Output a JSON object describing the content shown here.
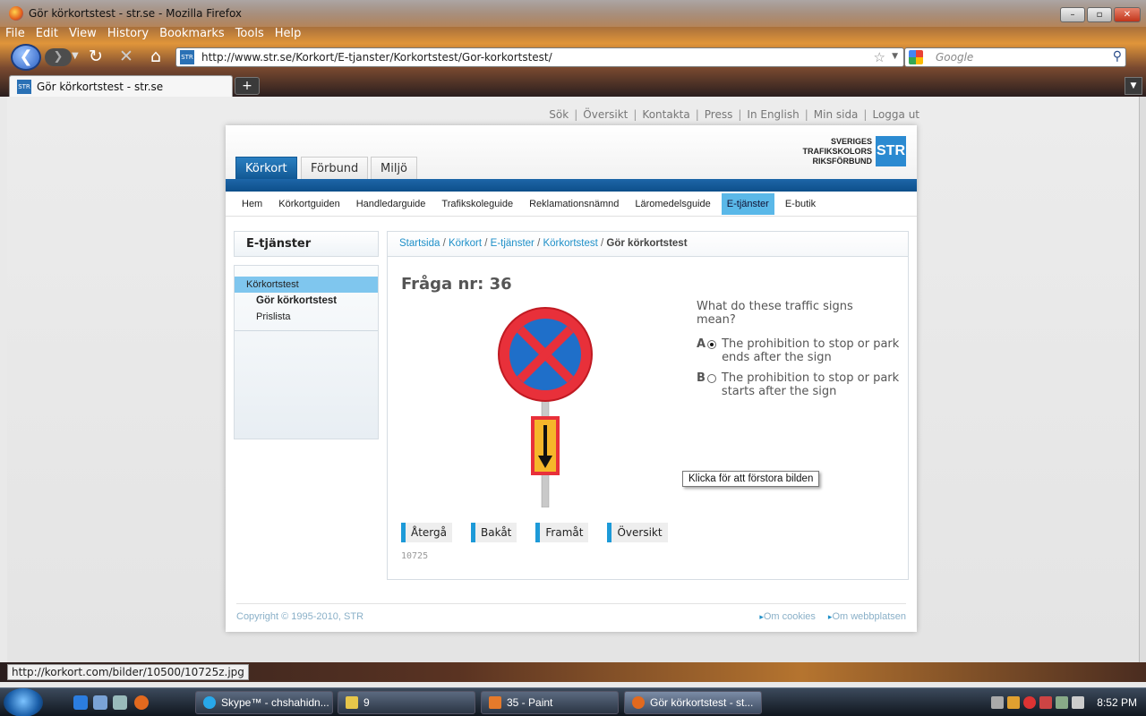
{
  "window": {
    "title": "Gör körkortstest - str.se - Mozilla Firefox"
  },
  "menu": [
    "File",
    "Edit",
    "View",
    "History",
    "Bookmarks",
    "Tools",
    "Help"
  ],
  "address": {
    "url": "http://www.str.se/Korkort/E-tjanster/Korkortstest/Gor-korkortstest/",
    "search_placeholder": "Google"
  },
  "tab": {
    "title": "Gör körkortstest - str.se",
    "new_tab": "+"
  },
  "site": {
    "toplinks": [
      "Sök",
      "Översikt",
      "Kontakta",
      "Press",
      "In English",
      "Min sida",
      "Logga ut"
    ],
    "maintabs": [
      "Körkort",
      "Förbund",
      "Miljö"
    ],
    "logo": {
      "line1": "SVERIGES",
      "line2": "TRAFIKSKOLORS",
      "line3": "RIKSFÖRBUND",
      "mark": "STR",
      "color": "#2b8ad1"
    },
    "subnav": [
      "Hem",
      "Körkortguiden",
      "Handledarguide",
      "Trafikskoleguide",
      "Reklamationsnämnd",
      "Läromedelsguide",
      "E-tjänster",
      "E-butik"
    ],
    "left": {
      "heading": "E-tjänster",
      "items": [
        "Körkortstest",
        "Gör körkortstest",
        "Prislista"
      ]
    },
    "breadcrumb": [
      "Startsida",
      "Körkort",
      "E-tjänster",
      "Körkortstest",
      "Gör körkortstest"
    ],
    "question": {
      "title": "Fråga nr: 36",
      "text": "What do these traffic signs mean?",
      "options": [
        {
          "letter": "A",
          "text": "The prohibition to stop or park ends after the sign",
          "selected": true
        },
        {
          "letter": "B",
          "text": "The prohibition to stop or park starts after the sign",
          "selected": false
        }
      ],
      "tooltip": "Klicka för att förstora bilden",
      "buttons": [
        "Återgå",
        "Bakåt",
        "Framåt",
        "Översikt"
      ],
      "id": "10725"
    },
    "footer": {
      "copyright": "Copyright © 1995-2010, STR",
      "links": [
        "Om cookies",
        "Om webbplatsen"
      ]
    }
  },
  "status": {
    "text": "http://korkort.com/bilder/10500/10725z.jpg"
  },
  "taskbar": {
    "tasks": [
      "Skype™ - chshahidn...",
      "9",
      "35 - Paint",
      "Gör körkortstest - st..."
    ],
    "clock": "8:52 PM"
  }
}
